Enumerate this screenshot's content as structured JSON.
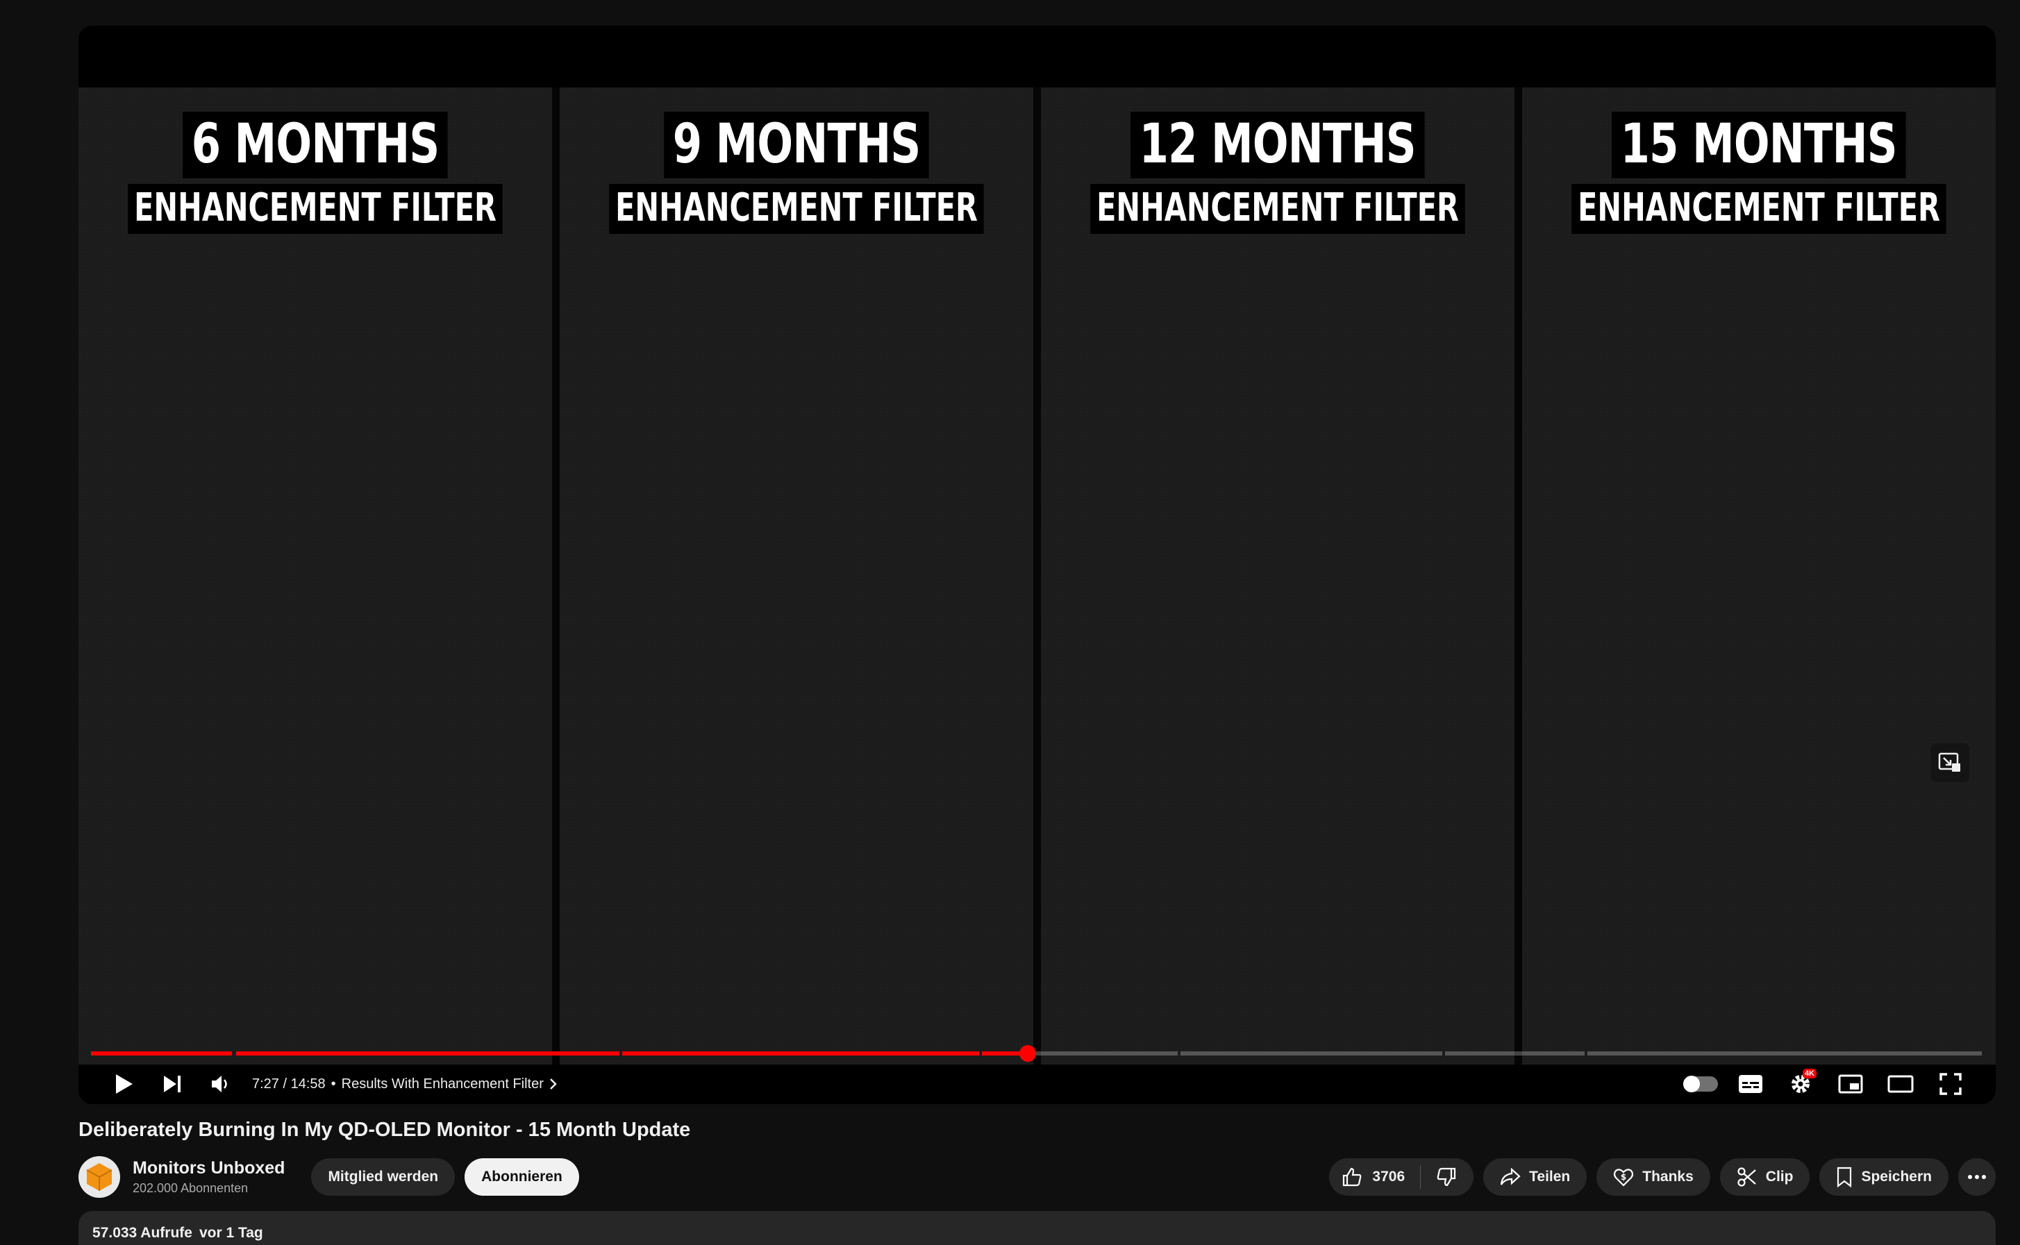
{
  "video": {
    "panels": [
      {
        "months": "6 MONTHS",
        "filter": "ENHANCEMENT FILTER"
      },
      {
        "months": "9 MONTHS",
        "filter": "ENHANCEMENT FILTER"
      },
      {
        "months": "12 MONTHS",
        "filter": "ENHANCEMENT FILTER"
      },
      {
        "months": "15 MONTHS",
        "filter": "ENHANCEMENT FILTER"
      }
    ],
    "progress_fraction": 0.495,
    "chapters": [
      0.076,
      0.278,
      0.469,
      0.574,
      0.715,
      0.794,
      0.752,
      0.0
    ],
    "accent_color": "#ff0000"
  },
  "controls": {
    "time": "7:27 / 14:58",
    "separator": "•",
    "chapter": "Results With Enhancement Filter",
    "settings_badge": "4K"
  },
  "meta": {
    "title": "Deliberately Burning In My QD-OLED Monitor - 15 Month Update",
    "channel_name": "Monitors Unboxed",
    "subscribers": "202.000 Abonnenten",
    "join_label": "Mitglied werden",
    "subscribe_label": "Abonnieren",
    "likes": "3706",
    "share_label": "Teilen",
    "thanks_label": "Thanks",
    "clip_label": "Clip",
    "save_label": "Speichern",
    "views": "57.033 Aufrufe",
    "date": "vor 1 Tag"
  }
}
